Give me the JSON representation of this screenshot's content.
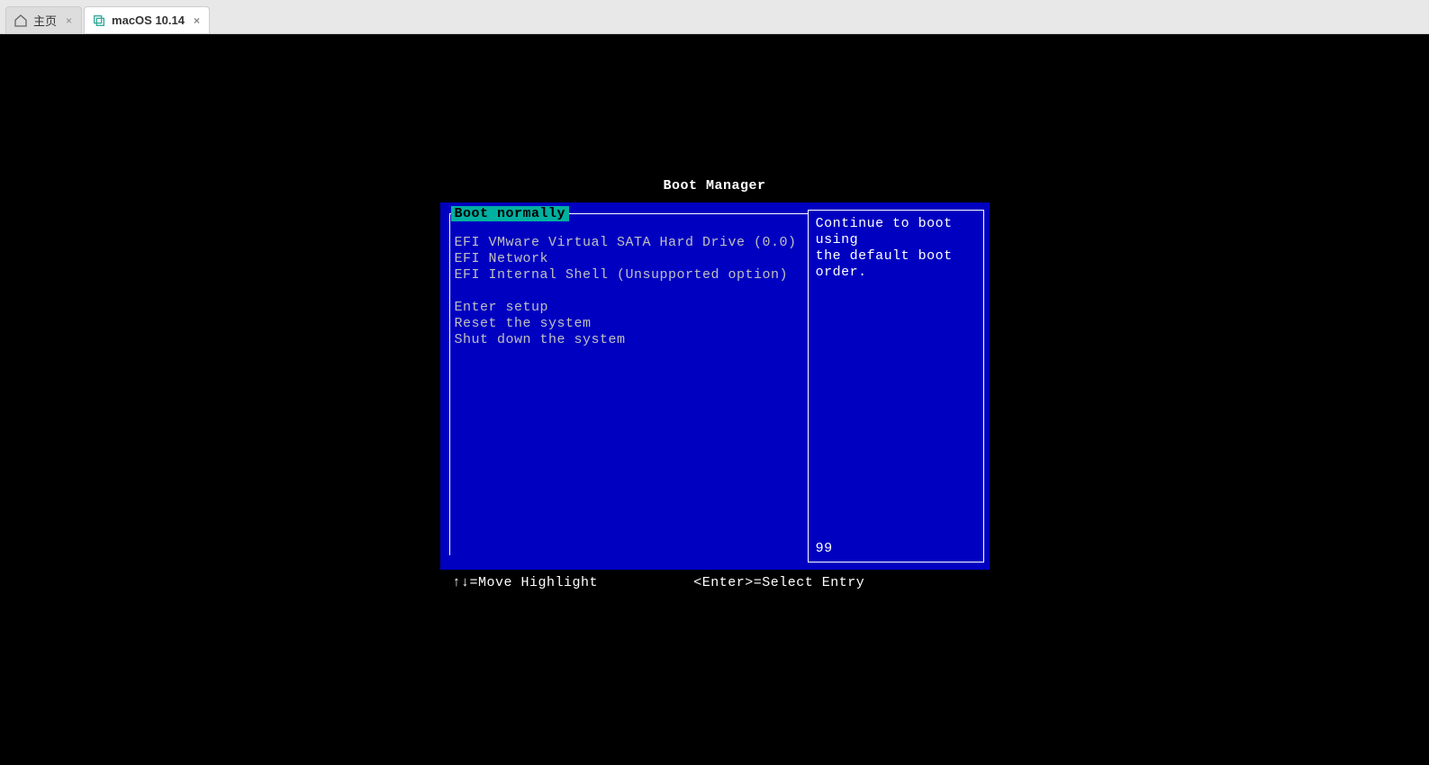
{
  "tabs": {
    "home_label": "主页",
    "vm_label": "macOS 10.14"
  },
  "boot": {
    "title": "Boot Manager",
    "selected": "Boot normally",
    "group1": {
      "item0": "EFI VMware Virtual SATA Hard Drive (0.0)",
      "item1": "EFI Network",
      "item2": "EFI Internal Shell (Unsupported option)"
    },
    "group2": {
      "item0": "Enter setup",
      "item1": "Reset the system",
      "item2": "Shut down the system"
    },
    "description_line1": "Continue to boot using",
    "description_line2": "the default boot order.",
    "counter": "99",
    "hint_move": "↑↓=Move Highlight",
    "hint_enter": "<Enter>=Select Entry"
  }
}
